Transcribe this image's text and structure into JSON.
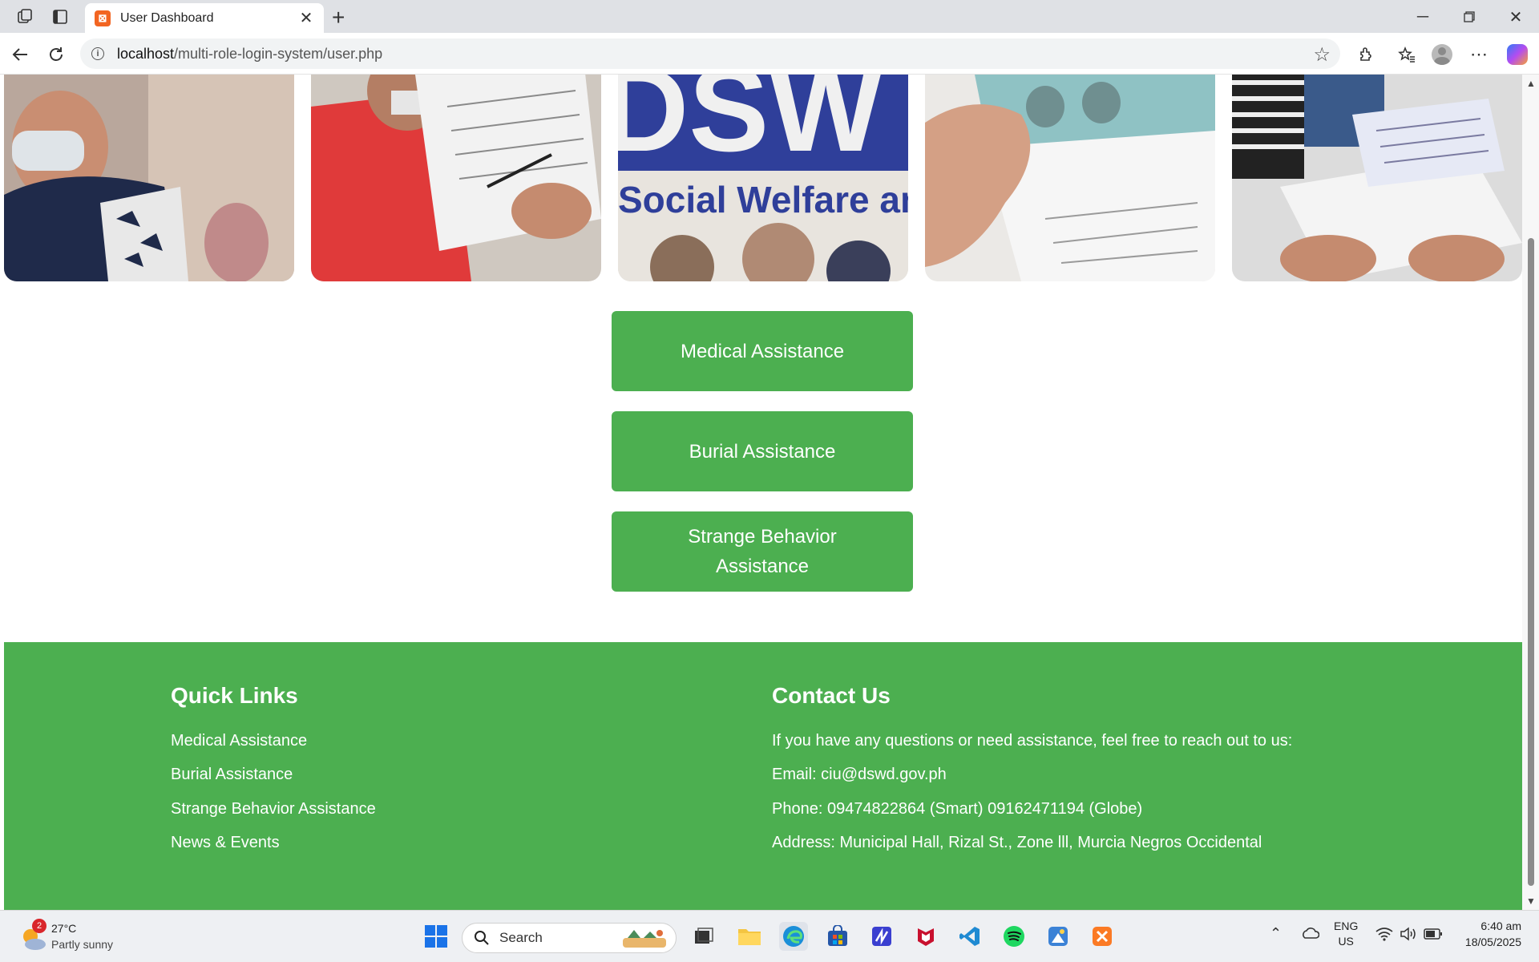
{
  "browser": {
    "tab_title": "User Dashboard",
    "tab_favicon_text": "⊠",
    "url_host": "localhost",
    "url_path": "/multi-role-login-system/user.php",
    "icons": [
      "workspaces-icon",
      "tab-actions-icon",
      "close-tab-icon",
      "new-tab-icon",
      "minimize-icon",
      "restore-icon",
      "window-close-icon",
      "back-icon",
      "refresh-icon",
      "site-info-icon",
      "favorite-star-icon",
      "extensions-icon",
      "favorites-icon",
      "profile-icon",
      "more-icon",
      "copilot-icon"
    ]
  },
  "gallery": {
    "images": [
      "people-in-masks-photo",
      "red-vest-signing-photo",
      "dswd-banner-photo",
      "cash-handover-photo",
      "document-table-photo"
    ],
    "banner_text": "Social Welfare an",
    "banner_logo": "DSW"
  },
  "buttons": {
    "medical": "Medical Assistance",
    "burial": "Burial Assistance",
    "strange": "Strange Behavior Assistance"
  },
  "footer": {
    "quick_links": {
      "heading": "Quick Links",
      "items": [
        "Medical Assistance",
        "Burial Assistance",
        "Strange Behavior Assistance",
        "News & Events"
      ]
    },
    "contact": {
      "heading": "Contact Us",
      "intro": "If you have any questions or need assistance, feel free to reach out to us:",
      "email": "Email: ciu@dswd.gov.ph",
      "phone": "Phone: 09474822864 (Smart) 09162471194 (Globe)",
      "address": "Address: Municipal Hall, Rizal St., Zone lll, Murcia Negros Occidental"
    },
    "bg_color": "#4caf50"
  },
  "taskbar": {
    "weather_temp": "27°C",
    "weather_desc": "Partly sunny",
    "weather_badge": "2",
    "search_placeholder": "Search",
    "lang_top": "ENG",
    "lang_bottom": "US",
    "time": "6:40 am",
    "date": "18/05/2025",
    "apps": [
      "start-icon",
      "search-icon",
      "task-view-icon",
      "file-explorer-icon",
      "edge-icon",
      "store-icon",
      "vpn-icon",
      "mcafee-icon",
      "vscode-icon",
      "spotify-icon",
      "paint-icon",
      "xampp-icon"
    ]
  }
}
